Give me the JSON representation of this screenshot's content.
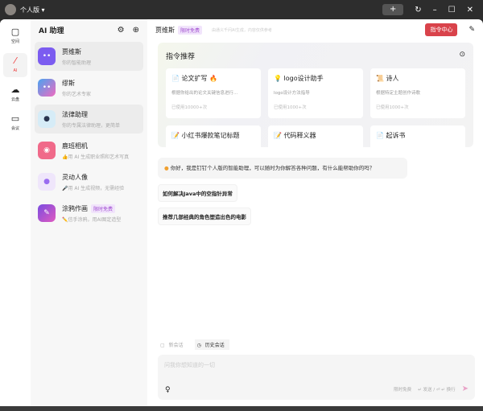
{
  "topbar": {
    "version": "个人版",
    "icons": [
      "plus-icon",
      "refresh-icon",
      "minimize-icon",
      "maximize-icon",
      "close-icon"
    ]
  },
  "nav": [
    {
      "label": "空间",
      "icon": "square-icon"
    },
    {
      "label": "AI",
      "icon": "ai-icon"
    },
    {
      "label": "云盘",
      "icon": "cloud-icon"
    },
    {
      "label": "会议",
      "icon": "video-icon"
    }
  ],
  "list": {
    "title": "AI 助理",
    "items": [
      {
        "name": "贾维斯",
        "desc": "你的智能助理",
        "color": "#7b5cf0"
      },
      {
        "name": "缪斯",
        "desc": "你的艺术专家",
        "color": "#4aa3f0"
      },
      {
        "name": "法律助理",
        "desc": "你的专属法律助理，更简单",
        "color": "#2a3550"
      },
      {
        "name": "鹿班相机",
        "desc": "👍用 AI 生成职业照和艺术写真",
        "color": "#f06a8a"
      },
      {
        "name": "灵动人像",
        "desc": "🎤用 AI 生成视频，无需经验",
        "color": "#9a6cf0"
      },
      {
        "name": "涂鸦作画",
        "tag": "限时免费",
        "desc": "✏️信手涂鸦，用AI图定造型",
        "color": "#7a4ce0"
      }
    ]
  },
  "header": {
    "title": "贾维斯",
    "tag": "限时免费",
    "subtitle": "由通义千问AI生成，内容仅供参考",
    "command_center": "指令中心"
  },
  "recommend": {
    "title": "指令推荐",
    "cards": [
      {
        "icon": "📄",
        "title": "论文扩写 🔥",
        "desc": "根据你给出的论文关键信息进行...",
        "usage": "已使用10000+次"
      },
      {
        "icon": "💡",
        "title": "logo设计助手",
        "desc": "logo设计方法指导",
        "usage": "已使用1000+次"
      },
      {
        "icon": "📜",
        "title": "诗人",
        "desc": "根据特定主题创作诗歌",
        "usage": "已使用1000+次"
      },
      {
        "icon": "📝",
        "title": "小红书爆款笔记标题",
        "desc": "",
        "usage": ""
      },
      {
        "icon": "📝",
        "title": "代码释义器",
        "desc": "",
        "usage": ""
      },
      {
        "icon": "📄",
        "title": "起诉书",
        "desc": "",
        "usage": ""
      }
    ]
  },
  "chat": {
    "greeting": "你好，我是钉钉个人版的智能助理，可以随时为你解答各种问题，有什么能帮助你的吗？",
    "suggestions": [
      "如何解决Java中的空指针异常",
      "推荐几部经典的角色塑造出色的电影"
    ]
  },
  "composer": {
    "new_session": "新会话",
    "history": "历史会话",
    "placeholder": "问我你想知道的一切",
    "free": "限时免费",
    "hint": "↵ 发送 / ⏎ ↵ 换行"
  }
}
